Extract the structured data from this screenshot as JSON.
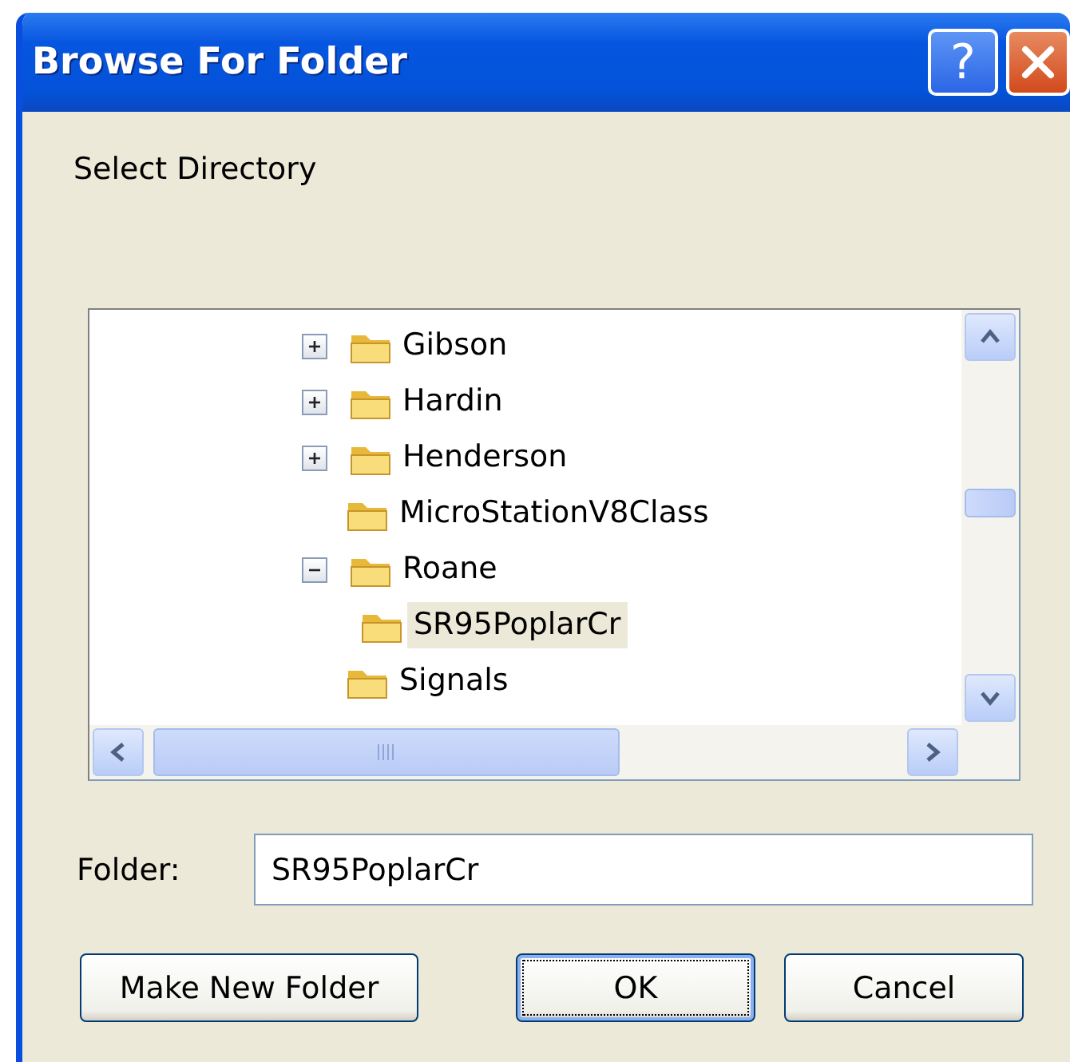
{
  "window": {
    "title": "Browse For Folder",
    "buttons": [
      {
        "kind": "help",
        "label": "?"
      },
      {
        "kind": "close"
      }
    ]
  },
  "prompt": "Select Directory",
  "tree": {
    "items": [
      {
        "label": "Gibson",
        "expandable": true,
        "expanded": false,
        "selected": false
      },
      {
        "label": "Hardin",
        "expandable": true,
        "expanded": false,
        "selected": false
      },
      {
        "label": "Henderson",
        "expandable": true,
        "expanded": false,
        "selected": false
      },
      {
        "label": "MicroStationV8Class",
        "expandable": false,
        "selected": false
      },
      {
        "label": "Roane",
        "expandable": true,
        "expanded": true,
        "selected": false,
        "children": [
          {
            "label": "SR95PoplarCr",
            "expandable": false,
            "selected": true
          }
        ]
      },
      {
        "label": "Signals",
        "expandable": false,
        "selected": false
      }
    ]
  },
  "folder_field": {
    "label": "Folder:",
    "value": "SR95PoplarCr"
  },
  "buttons": [
    {
      "label": "Make New Folder",
      "default": false
    },
    {
      "label": "OK",
      "default": true
    },
    {
      "label": "Cancel",
      "default": false
    }
  ]
}
